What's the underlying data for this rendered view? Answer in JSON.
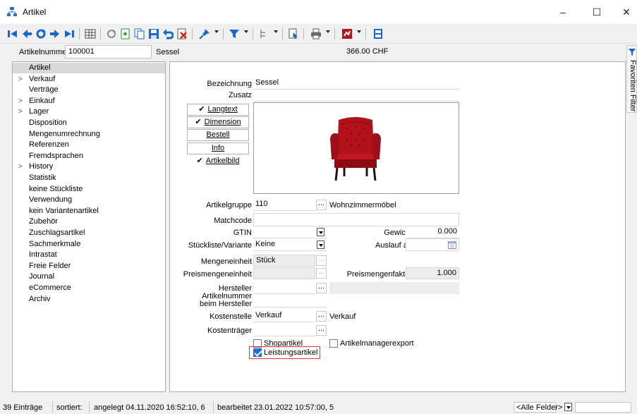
{
  "window": {
    "title": "Artikel",
    "minimize": "–",
    "maximize": "☐",
    "close": "✕"
  },
  "header": {
    "label": "Artikelnummer",
    "number": "100001",
    "name": "Sessel",
    "price": "366.00 CHF"
  },
  "nav": {
    "items": [
      {
        "label": "Artikel",
        "expand": "",
        "selected": true
      },
      {
        "label": "Verkauf",
        "expand": ">"
      },
      {
        "label": "Verträge",
        "expand": ""
      },
      {
        "label": "Einkauf",
        "expand": ">"
      },
      {
        "label": "Lager",
        "expand": ">"
      },
      {
        "label": "Disposition",
        "expand": ""
      },
      {
        "label": "Mengenumrechnung",
        "expand": ""
      },
      {
        "label": "Referenzen",
        "expand": ""
      },
      {
        "label": "Fremdsprachen",
        "expand": ""
      },
      {
        "label": "History",
        "expand": ">"
      },
      {
        "label": "Statistik",
        "expand": ""
      },
      {
        "label": "keine Stückliste",
        "expand": ""
      },
      {
        "label": "Verwendung",
        "expand": ""
      },
      {
        "label": "kein Variantenartikel",
        "expand": ""
      },
      {
        "label": "Zubehör",
        "expand": ""
      },
      {
        "label": "Zuschlagsartikel",
        "expand": ""
      },
      {
        "label": "Sachmerkmale",
        "expand": ""
      },
      {
        "label": "Intrastat",
        "expand": ""
      },
      {
        "label": "Freie Felder",
        "expand": ""
      },
      {
        "label": "Journal",
        "expand": ""
      },
      {
        "label": "eCommerce",
        "expand": ""
      },
      {
        "label": "Archiv",
        "expand": ""
      }
    ]
  },
  "form": {
    "bezeichnung_label": "Bezeichnung",
    "bezeichnung": "Sessel",
    "zusatz_label": "Zusatz",
    "zusatz": "",
    "buttons": {
      "langtext": "Langtext",
      "dimension": "Dimension",
      "bestell": "Bestell",
      "info": "Info",
      "artikelbild": "Artikelbild",
      "check": "✔"
    },
    "artikelgruppe_label": "Artikelgruppe",
    "artikelgruppe": "110",
    "artikelgruppe_name": "Wohnzimmermöbel",
    "matchcode_label": "Matchcode",
    "matchcode": "",
    "gtin_label": "GTIN",
    "gtin": "",
    "gewicht_label": "Gewicht",
    "gewicht": "0.000",
    "stueckliste_label": "Stückliste/Variante",
    "stueckliste": "Keine",
    "auslauf_label": "Auslauf ab",
    "auslauf": "",
    "mengeneinheit_label": "Mengeneinheit",
    "mengeneinheit": "Stück",
    "preismengeneinheit_label": "Preismengeneinheit",
    "preismengeneinheit": "",
    "preismengenfaktor_label": "Preismengenfaktor",
    "preismengenfaktor": "1.000",
    "hersteller_label": "Hersteller",
    "hersteller": "",
    "artnr_hersteller_label_1": "Artikelnummer",
    "artnr_hersteller_label_2": "beim Hersteller",
    "artnr_hersteller": "",
    "kostenstelle_label": "Kostenstelle",
    "kostenstelle": "Verkauf",
    "kostenstelle_name": "Verkauf",
    "kostentraeger_label": "Kostenträger",
    "kostentraeger": "",
    "ellipsis": "...",
    "shopartikel_label": "Shopartikel",
    "shopartikel": false,
    "artikelmanager_label": "Artikelmanagerexport",
    "artikelmanager": false,
    "leistungsartikel_label": "Leistungsartikel",
    "leistungsartikel": true
  },
  "sidepanel": {
    "label": "Favoriten Filter"
  },
  "status": {
    "count": "39 Einträge",
    "sorted": "sortiert:",
    "created": "angelegt 04.11.2020 16:52:10, 6",
    "edited": "bearbeitet 23.01.2022 10:57:00, 5",
    "filter": "<Alle Felder>"
  },
  "colors": {
    "highlight_border": "#e0353b",
    "checkbox_checked": "#1e6ed9",
    "nav_selected": "#d9d9d9",
    "chair_red": "#b3121d"
  }
}
